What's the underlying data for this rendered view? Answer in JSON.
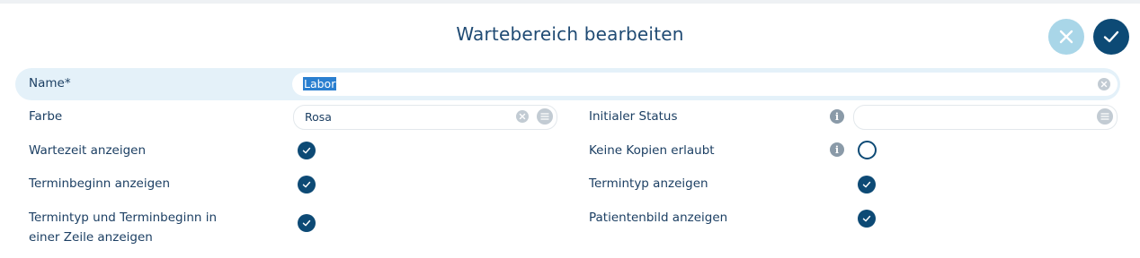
{
  "dialog": {
    "title": "Wartebereich bearbeiten"
  },
  "actions": {
    "cancel_icon": "close-icon",
    "confirm_icon": "check-icon"
  },
  "form": {
    "name": {
      "label": "Name*",
      "value": "Labor",
      "selected": true
    },
    "farbe": {
      "label": "Farbe",
      "value": "Rosa"
    },
    "initialer_status": {
      "label": "Initialer Status",
      "value": "",
      "info_icon": "info-icon",
      "info_glyph": "i"
    },
    "wartezeit_anzeigen": {
      "label": "Wartezeit anzeigen",
      "checked": true
    },
    "keine_kopien": {
      "label": "Keine Kopien erlaubt",
      "checked": false,
      "info_icon": "info-icon",
      "info_glyph": "i"
    },
    "terminbeginn_anzeigen": {
      "label": "Terminbeginn anzeigen",
      "checked": true
    },
    "termintyp_anzeigen": {
      "label": "Termintyp anzeigen",
      "checked": true
    },
    "termintyp_terminbeginn_zeile": {
      "label_line1": "Termintyp und Terminbeginn in",
      "label_line2": "einer Zeile anzeigen",
      "checked": true
    },
    "patientenbild_anzeigen": {
      "label": "Patientenbild anzeigen",
      "checked": true
    }
  },
  "colors": {
    "primary": "#0d4a75",
    "cancel_bg": "#a9d6e8",
    "highlight_row": "#e4f1f9",
    "selection": "#2a7fd0"
  }
}
